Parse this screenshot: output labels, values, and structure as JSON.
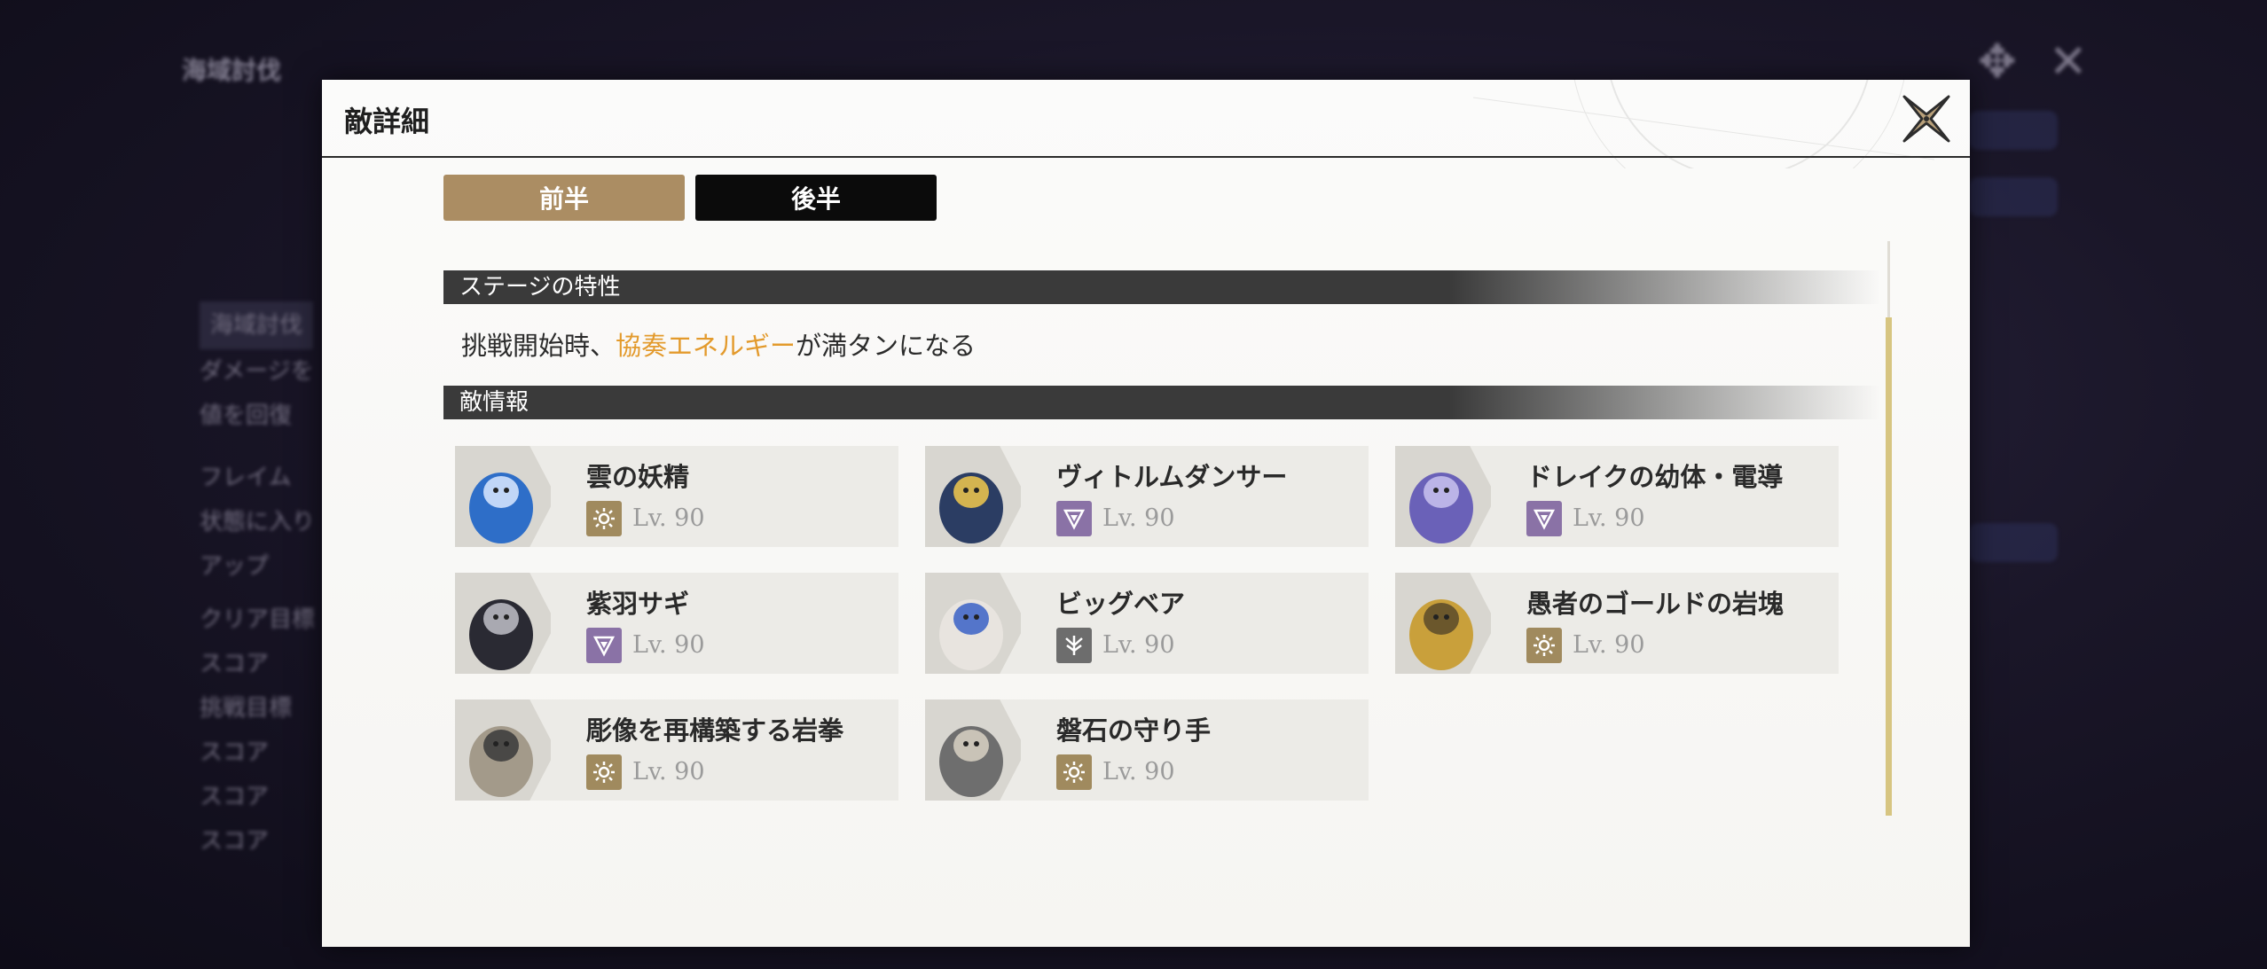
{
  "background": {
    "app_title": "海域討伐",
    "side_items": [
      "海域討伐",
      "ダメージを",
      "値を回復",
      "フレイム",
      "状態に入り",
      "アップ",
      "クリア目標",
      "スコア",
      "挑戦目標",
      "スコア",
      "スコア",
      "スコア"
    ]
  },
  "modal": {
    "title": "敵詳細",
    "tabs": [
      {
        "label": "前半",
        "active": true
      },
      {
        "label": "後半",
        "active": false
      }
    ],
    "stage_section": "ステージの特性",
    "trait": {
      "prefix": "挑戦開始時、",
      "accent": "協奏エネルギー",
      "suffix": "が満タンになる"
    },
    "enemy_section": "敵情報",
    "enemies": [
      {
        "name": "雲の妖精",
        "level": "Lv. 90",
        "element": "sun"
      },
      {
        "name": "ヴィトルムダンサー",
        "level": "Lv. 90",
        "element": "void"
      },
      {
        "name": "ドレイクの幼体・電導",
        "level": "Lv. 90",
        "element": "void"
      },
      {
        "name": "紫羽サギ",
        "level": "Lv. 90",
        "element": "void"
      },
      {
        "name": "ビッグベア",
        "level": "Lv. 90",
        "element": "wind"
      },
      {
        "name": "愚者のゴールドの岩塊",
        "level": "Lv. 90",
        "element": "sun"
      },
      {
        "name": "彫像を再構築する岩拳",
        "level": "Lv. 90",
        "element": "sun"
      },
      {
        "name": "磐石の守り手",
        "level": "Lv. 90",
        "element": "sun"
      }
    ]
  },
  "colors": {
    "tab_active": "#ab8d63",
    "tab_inactive": "#0b0b0b",
    "accent": "#e39a2c",
    "element_sun": "#a08a5e",
    "element_void": "#8a72a6",
    "element_wind": "#6d6d6d",
    "scroll_thumb": "#d7c581"
  }
}
